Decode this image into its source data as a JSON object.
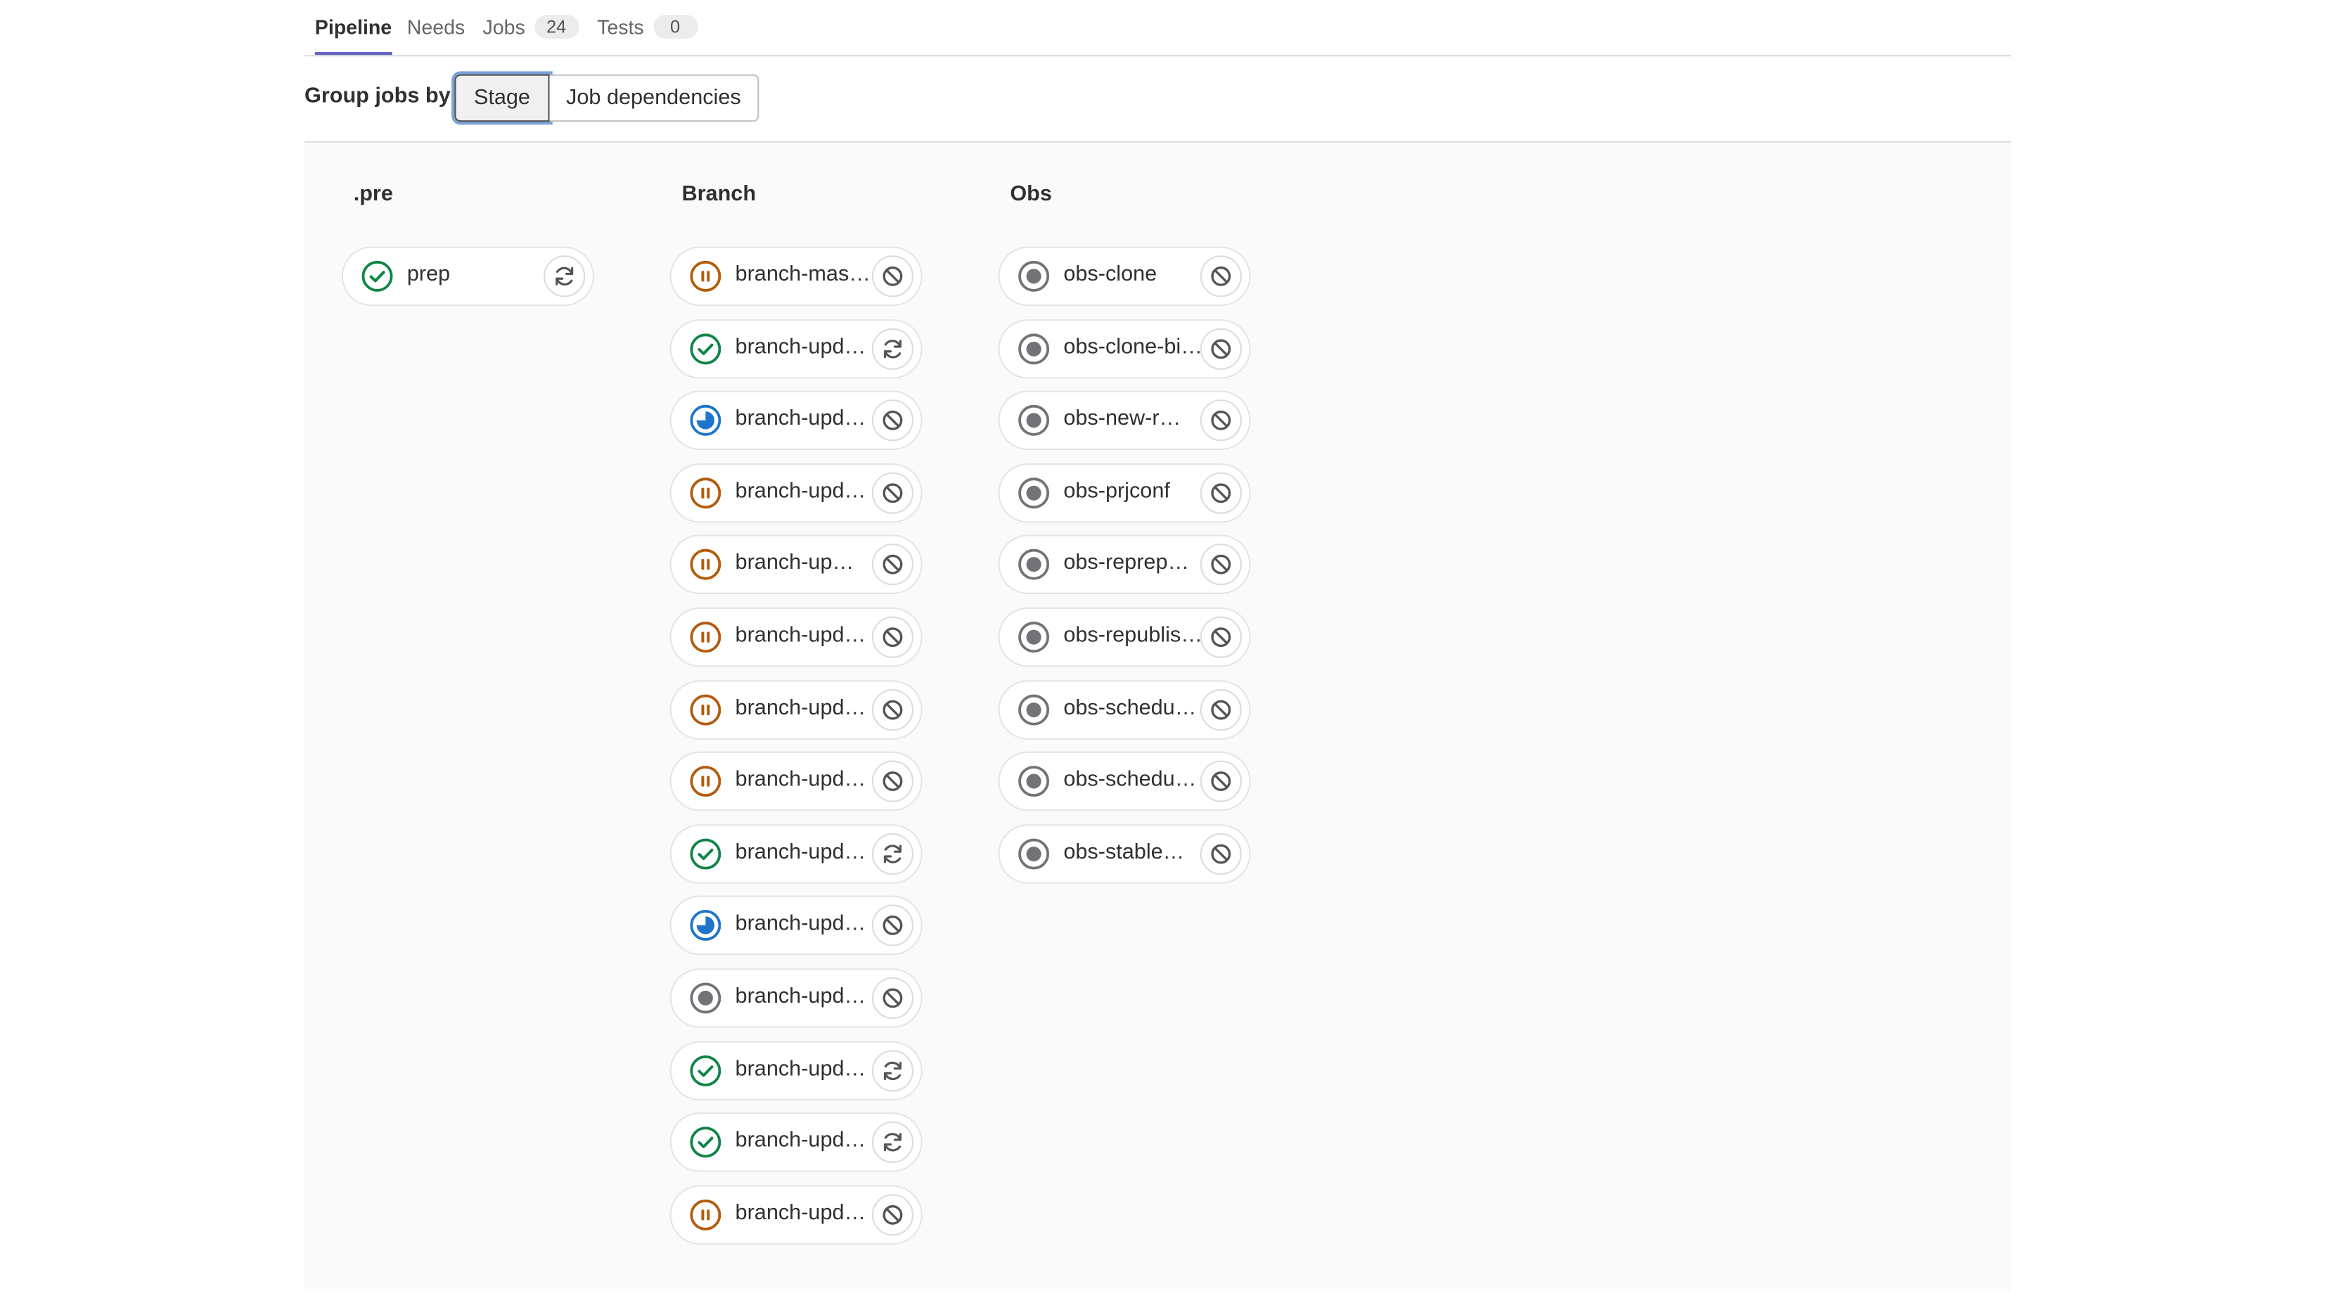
{
  "tabs": [
    {
      "label": "Pipeline",
      "active": true
    },
    {
      "label": "Needs"
    },
    {
      "label": "Jobs",
      "badge": "24"
    },
    {
      "label": "Tests",
      "badge": "0"
    }
  ],
  "group_by": {
    "label": "Group jobs by",
    "options": [
      "Stage",
      "Job dependencies"
    ],
    "selected": "Stage"
  },
  "stages": [
    {
      "title": ".pre",
      "jobs": [
        {
          "name": "prep",
          "status": "success",
          "action": "retry"
        }
      ]
    },
    {
      "title": "Branch",
      "jobs": [
        {
          "name": "branch-mass…",
          "status": "manual",
          "action": "cancel"
        },
        {
          "name": "branch-updat…",
          "status": "success",
          "action": "retry"
        },
        {
          "name": "branch-updat…",
          "status": "running",
          "action": "cancel"
        },
        {
          "name": "branch-updat…",
          "status": "manual",
          "action": "cancel"
        },
        {
          "name": "branch-up…",
          "status": "manual",
          "action": "cancel"
        },
        {
          "name": "branch-updat…",
          "status": "manual",
          "action": "cancel"
        },
        {
          "name": "branch-updat…",
          "status": "manual",
          "action": "cancel"
        },
        {
          "name": "branch-updat…",
          "status": "manual",
          "action": "cancel"
        },
        {
          "name": "branch-updat…",
          "status": "success",
          "action": "retry"
        },
        {
          "name": "branch-updat…",
          "status": "running",
          "action": "cancel"
        },
        {
          "name": "branch-updat…",
          "status": "created",
          "action": "cancel"
        },
        {
          "name": "branch-updat…",
          "status": "success",
          "action": "retry"
        },
        {
          "name": "branch-updat…",
          "status": "success",
          "action": "retry"
        },
        {
          "name": "branch-updat…",
          "status": "manual",
          "action": "cancel"
        }
      ]
    },
    {
      "title": "Obs",
      "jobs": [
        {
          "name": "obs-clone",
          "status": "created",
          "action": "cancel"
        },
        {
          "name": "obs-clone-bi…",
          "status": "created",
          "action": "cancel"
        },
        {
          "name": "obs-new-r…",
          "status": "created",
          "action": "cancel"
        },
        {
          "name": "obs-prjconf",
          "status": "created",
          "action": "cancel"
        },
        {
          "name": "obs-reprep…",
          "status": "created",
          "action": "cancel"
        },
        {
          "name": "obs-republis…",
          "status": "created",
          "action": "cancel"
        },
        {
          "name": "obs-schedu…",
          "status": "created",
          "action": "cancel"
        },
        {
          "name": "obs-schedu…",
          "status": "created",
          "action": "cancel"
        },
        {
          "name": "obs-stable…",
          "status": "created",
          "action": "cancel"
        }
      ]
    }
  ],
  "colors": {
    "success": "#108548",
    "manual": "#b35c0c",
    "running": "#1f75cb",
    "created": "#737278",
    "tab_underline": "#6666c4"
  },
  "icons": {
    "success": "status-success-icon",
    "manual": "status-manual-icon",
    "running": "status-running-icon",
    "created": "status-created-icon",
    "retry": "retry-icon",
    "cancel": "cancel-icon"
  }
}
